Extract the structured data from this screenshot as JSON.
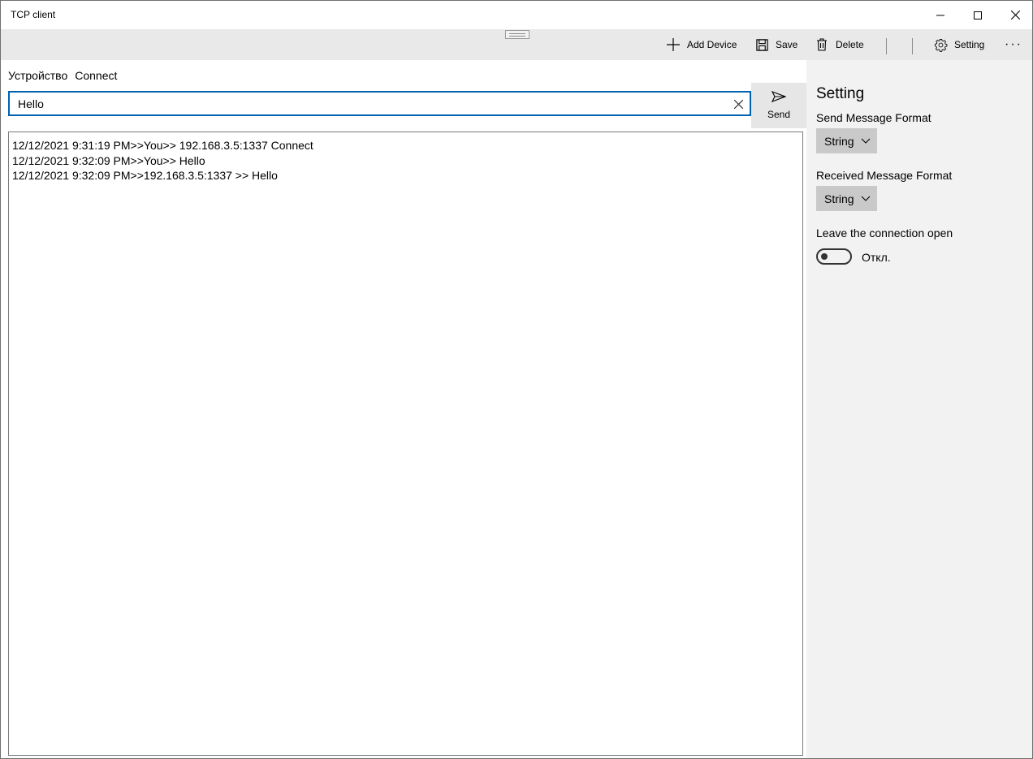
{
  "window": {
    "title": "TCP client"
  },
  "commandbar": {
    "add_device": "Add Device",
    "save": "Save",
    "delete": "Delete",
    "setting": "Setting",
    "more": "···"
  },
  "device_row": {
    "device": "Устройство",
    "connect": "Connect"
  },
  "message_input": {
    "value": "Hello",
    "placeholder": ""
  },
  "send_button": {
    "label": "Send"
  },
  "log": [
    "12/12/2021 9:31:19 PM>>You>> 192.168.3.5:1337 Connect",
    "12/12/2021 9:32:09 PM>>You>> Hello",
    "12/12/2021 9:32:09 PM>>192.168.3.5:1337 >> Hello"
  ],
  "settings": {
    "title": "Setting",
    "send_format_label": "Send Message Format",
    "send_format_value": "String",
    "received_format_label": "Received Message Format",
    "received_format_value": "String",
    "leave_open_label": "Leave the connection open",
    "leave_open_state": "Откл.",
    "leave_open_on": false
  },
  "colors": {
    "accent": "#0063b1",
    "commandbar_bg": "#e9e9e9",
    "panel_bg": "#f2f2f2",
    "combo_bg": "#c9c9c9"
  }
}
